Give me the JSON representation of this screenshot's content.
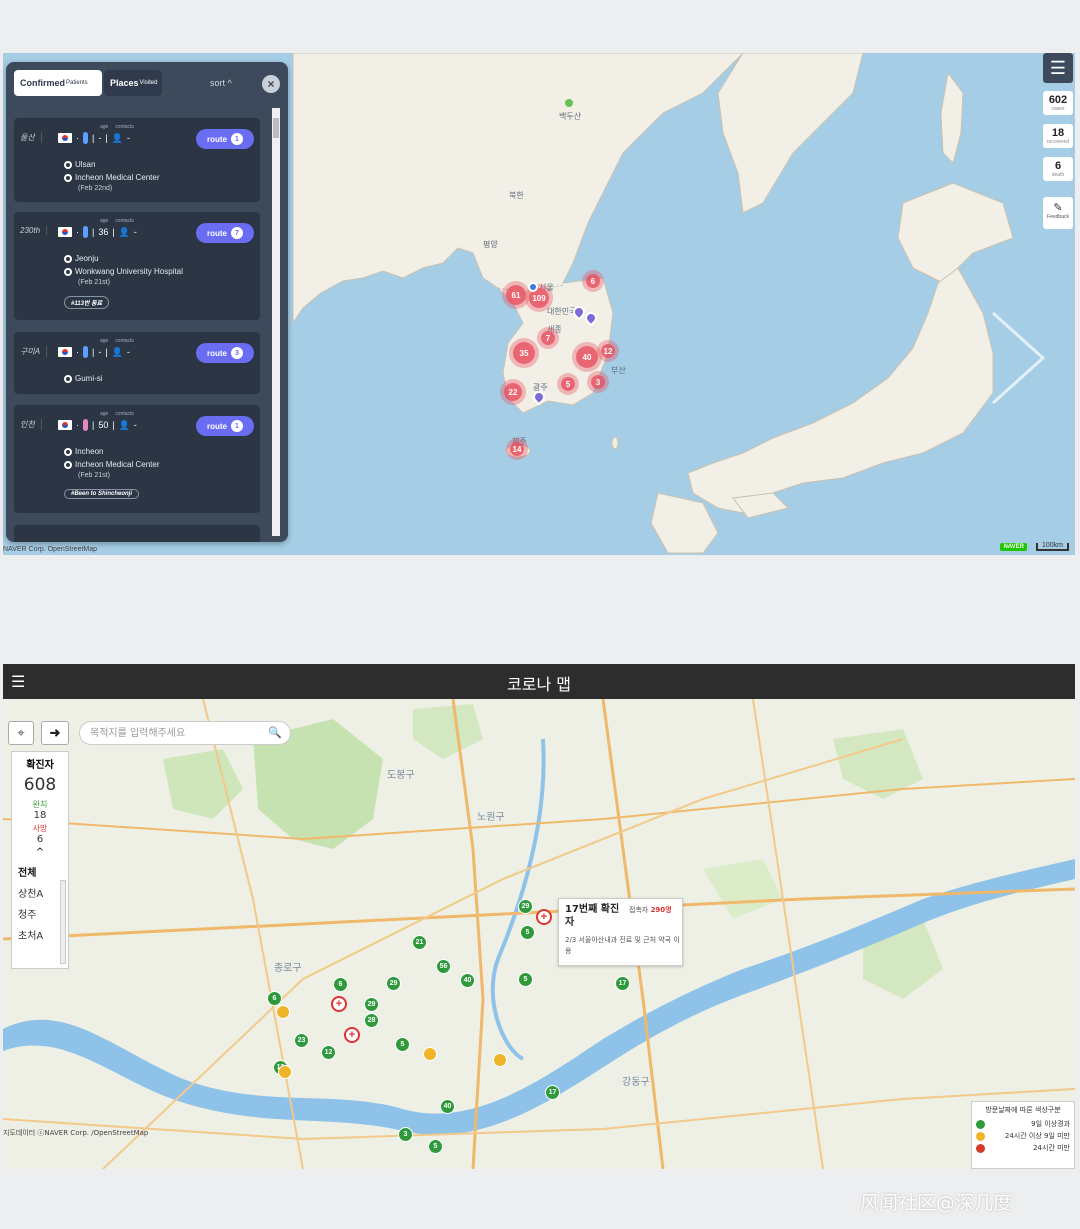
{
  "top_map": {
    "labels": {
      "north_korea": "북한",
      "south_korea": "대한민국",
      "baekdusan": "백두산",
      "pyongyang": "평양",
      "seoul": "서울",
      "sejong": "세종",
      "gwangju": "광주",
      "busan": "부산",
      "jeju": "제주"
    },
    "clusters": [
      "61",
      "109",
      "6",
      "7",
      "35",
      "40",
      "12",
      "22",
      "5",
      "3",
      "14"
    ],
    "attribution": "NAVER Corp. OpenStreetMap",
    "naver_logo": "NAVER",
    "scale": "100km",
    "menu_icon": "hamburger-icon"
  },
  "stats": {
    "cases": "602",
    "cases_label": "cases",
    "recovered": "18",
    "recovered_label": "recovered",
    "death": "6",
    "death_label": "death",
    "feedback": "Feedback"
  },
  "panel": {
    "tab_confirmed": "Confirmed",
    "tab_confirmed_sub": "Patients",
    "tab_places": "Places",
    "tab_places_sub": "Visited",
    "sort": "sort",
    "close": "×",
    "meta_age": "age",
    "meta_contacts": "contacts",
    "route_label": "route",
    "cards": [
      {
        "id": "울산",
        "age": "-",
        "contacts": "-",
        "route_count": "1",
        "location": "Ulsan",
        "hospital": "Incheon Medical Center",
        "date": "(Feb 22nd)",
        "tag": "",
        "gender": "m"
      },
      {
        "id": "230th",
        "age": "36",
        "contacts": "-",
        "route_count": "7",
        "location": "Jeonju",
        "hospital": "Wonkwang University Hospital",
        "date": "(Feb 21st)",
        "tag": "#113번 동료",
        "gender": "m"
      },
      {
        "id": "구미A",
        "age": "-",
        "contacts": "-",
        "route_count": "3",
        "location": "Gumi-si",
        "hospital": "",
        "date": "",
        "tag": "",
        "gender": "m"
      },
      {
        "id": "인천",
        "age": "50",
        "contacts": "-",
        "route_count": "1",
        "location": "Incheon",
        "hospital": "Incheon Medical Center",
        "date": "(Feb 21st)",
        "tag": "#Been to Shincheonji",
        "gender": "f"
      }
    ]
  },
  "bottom": {
    "app_title": "코로나 맵",
    "search_placeholder": "목적지를 입력해주세요",
    "stats": {
      "title": "확진자",
      "count": "608",
      "recovered_label": "완치",
      "recovered": "18",
      "death_label": "사망",
      "death": "6",
      "collapse": "^",
      "items": [
        "전체",
        "상천A",
        "청주",
        "초처A"
      ]
    },
    "popup": {
      "title": "17번째 확진자",
      "visitors_label": "접촉자",
      "visitors": "290명",
      "desc": "2/3 서울아산내과 진료 및 근처 약국 이용"
    },
    "legend": {
      "title": "방문날짜에 따른 색상구분",
      "items": [
        {
          "label": "9일 이상경과",
          "color": "#2e9a3c"
        },
        {
          "label": "24시간 이상 9일 미만",
          "color": "#f0b429"
        },
        {
          "label": "24시간 미만",
          "color": "#d33a2c"
        }
      ]
    },
    "districts": [
      "도봉구",
      "노원구",
      "종로구",
      "강동구"
    ],
    "markers": [
      "29",
      "5",
      "21",
      "56",
      "40",
      "5",
      "17",
      "6",
      "29",
      "29",
      "28",
      "23",
      "12",
      "12",
      "5",
      "6",
      "17",
      "40",
      "3",
      "5"
    ],
    "attribution": "지도데이터 ⓒNAVER Corp. /OpenStreetMap"
  },
  "watermark": "风闻社区@深几度",
  "colors": {
    "panel": "#3d4a5c",
    "card": "#2b3544",
    "route": "#6a6df2",
    "cluster": "#e84c5c",
    "sea": "#a6cde6",
    "land": "#f2efe6"
  }
}
